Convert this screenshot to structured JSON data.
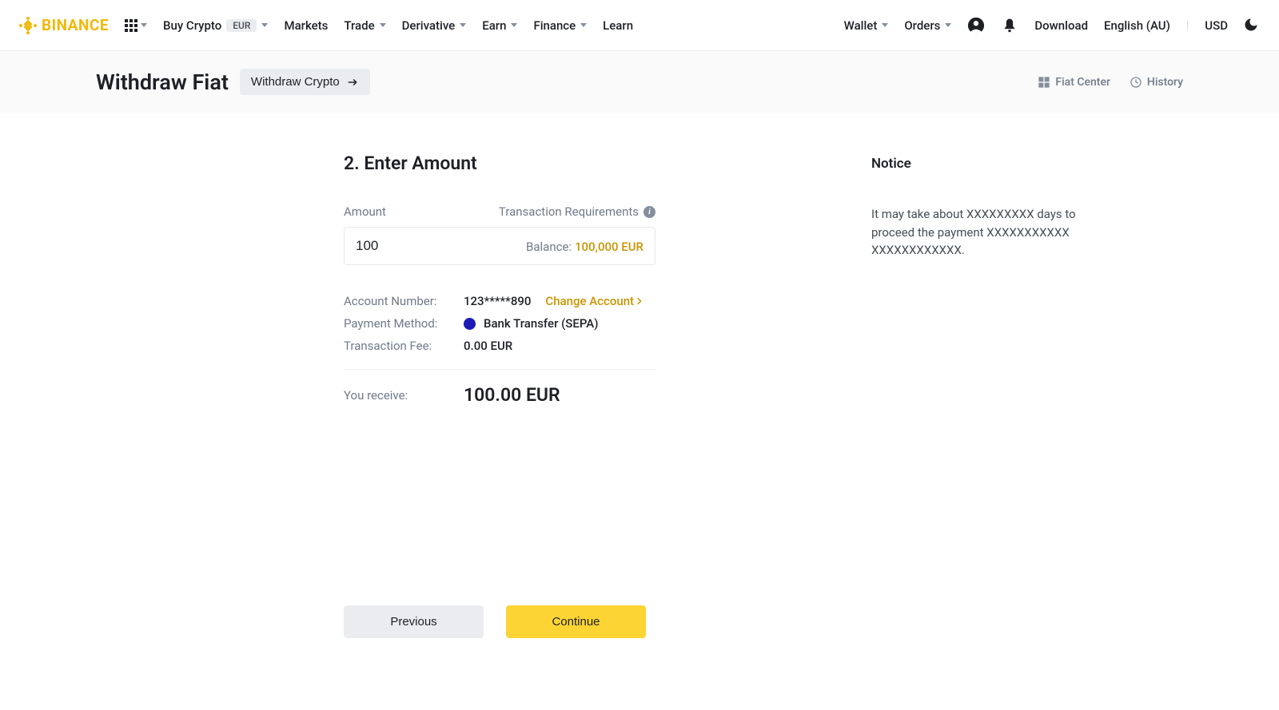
{
  "brand": "BINANCE",
  "nav": {
    "buy_crypto": "Buy Crypto",
    "currency_pill": "EUR",
    "markets": "Markets",
    "trade": "Trade",
    "derivative": "Derivative",
    "earn": "Earn",
    "finance": "Finance",
    "learn": "Learn",
    "wallet": "Wallet",
    "orders": "Orders",
    "download": "Download",
    "language": "English (AU)",
    "fiat": "USD"
  },
  "subheader": {
    "title": "Withdraw Fiat",
    "crypto_btn": "Withdraw Crypto",
    "fiat_center": "Fiat Center",
    "history": "History"
  },
  "form": {
    "step_title": "2. Enter Amount",
    "amount_label": "Amount",
    "tx_req_label": "Transaction Requirements",
    "amount_value": "100",
    "balance_label": "Balance:",
    "balance_value": "100,000 EUR",
    "account_number_label": "Account Number:",
    "account_number_value": "123*****890",
    "change_account": "Change Account",
    "payment_method_label": "Payment Method:",
    "payment_method_value": "Bank Transfer (SEPA)",
    "fee_label": "Transaction Fee:",
    "fee_value": "0.00 EUR",
    "receive_label": "You receive:",
    "receive_value": "100.00 EUR"
  },
  "notice": {
    "title": "Notice",
    "text": "It may take about XXXXXXXXX days to proceed the payment XXXXXXXXXXX XXXXXXXXXXXX."
  },
  "buttons": {
    "previous": "Previous",
    "continue": "Continue"
  }
}
